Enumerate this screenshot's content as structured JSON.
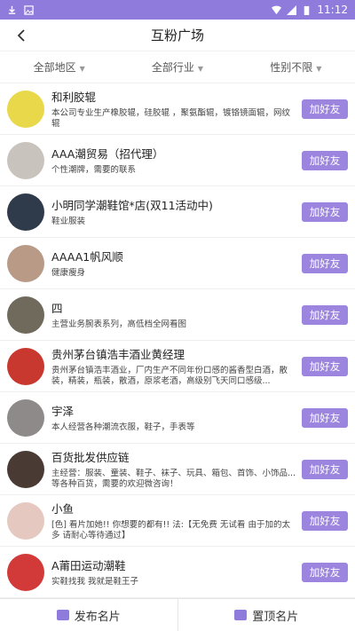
{
  "status_bar": {
    "time": "11:12"
  },
  "header": {
    "title": "互粉广场"
  },
  "filters": [
    {
      "label": "全部地区"
    },
    {
      "label": "全部行业"
    },
    {
      "label": "性别不限"
    }
  ],
  "add_button_label": "加好友",
  "items": [
    {
      "name": "和利胶辊",
      "desc": "本公司专业生产橡胶辊，硅胶辊 ，聚氨酯辊，镀铬镜面辊，网纹辊",
      "avatar_color": "#e9d84a"
    },
    {
      "name": "AAA潮贸易（招代理）",
      "desc": "个性潮牌，需要的联系",
      "avatar_color": "#c9c3bd"
    },
    {
      "name": "小明同学潮鞋馆*店(双11活动中)",
      "desc": "鞋业服装",
      "avatar_color": "#2f3a4a"
    },
    {
      "name": "AAAA1帆风顺",
      "desc": "健康瘦身",
      "avatar_color": "#b89a86"
    },
    {
      "name": "四",
      "desc": "主营业务腕表系列，高低档全网看图",
      "avatar_color": "#6f6a5c"
    },
    {
      "name": "贵州茅台镇浩丰酒业黄经理",
      "desc": "贵州茅台镇浩丰酒业，厂内生产不同年份口感的酱香型白酒，散装，精装，瓶装，散酒，原浆老酒，高级别飞天同口感级...",
      "avatar_color": "#c9382e"
    },
    {
      "name": "宇泽",
      "desc": "本人经营各种潮流衣服，鞋子，手表等",
      "avatar_color": "#8e8a8a"
    },
    {
      "name": "百货批发供应链",
      "desc": "主经营：服装、童装、鞋子、袜子、玩具、箱包、首饰、小饰品...等各种百货，需要的欢迎微咨询！",
      "avatar_color": "#4a3a34"
    },
    {
      "name": "小鱼",
      "desc": "[色] 看片加她!! 你想要的都有!! 法:【无免费 无试看 由于加的太多 请耐心等待通过】",
      "avatar_color": "#e5c8c0"
    },
    {
      "name": "A莆田运动潮鞋",
      "desc": "实鞋找我 我就是鞋王子",
      "avatar_color": "#d23a3a"
    }
  ],
  "footer": {
    "publish_label": "发布名片",
    "top_label": "置顶名片"
  },
  "colors": {
    "accent": "#8f7bdb",
    "button": "#9b85df"
  }
}
